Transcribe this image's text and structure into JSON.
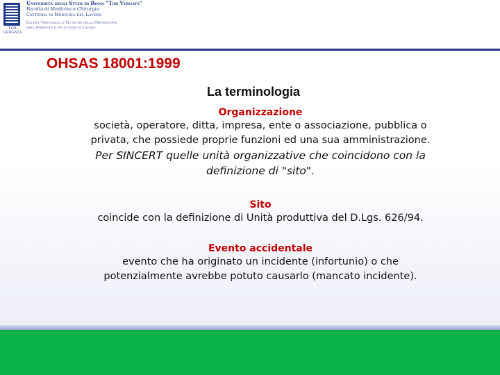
{
  "header": {
    "logo_caption": "TOR VERGATA",
    "institution_line1": "Università degli Studi di Roma \"Tor Vergata\"",
    "institution_line2": "Facoltà di Medicina e Chirurgia",
    "institution_line3": "Cattedra di Medicina del Lavoro",
    "institution_line4": "Laurea Triennale in Tecniche della Prevenzione",
    "institution_line5": "nell'Ambiente e nei Luoghi di Lavoro"
  },
  "slide": {
    "title": "OHSAS 18001:1999",
    "subtitle": "La terminologia",
    "sections": [
      {
        "heading": "Organizzazione",
        "lines": [
          "società, operatore, ditta, impresa, ente o associazione, pubblica o",
          "privata, che possiede proprie funzioni ed una sua amministrazione."
        ],
        "note_lines": [
          "Per SINCERT quelle unità organizzative che coincidono con la",
          "definizione di \"sito\"."
        ]
      },
      {
        "heading": "Sito",
        "lines": [
          "coincide con la definizione di Unità produttiva del D.Lgs. 626/94."
        ]
      },
      {
        "heading": "Evento accidentale",
        "lines": [
          "evento che ha originato un incidente (infortunio) o che",
          "potenzialmente avrebbe potuto causarlo (mancato incidente)."
        ]
      }
    ]
  },
  "colors": {
    "title": "#c00000",
    "heading": "#c00000",
    "rule": "#27328a",
    "footer": "#0ab24a",
    "institution": "#223a8a"
  }
}
